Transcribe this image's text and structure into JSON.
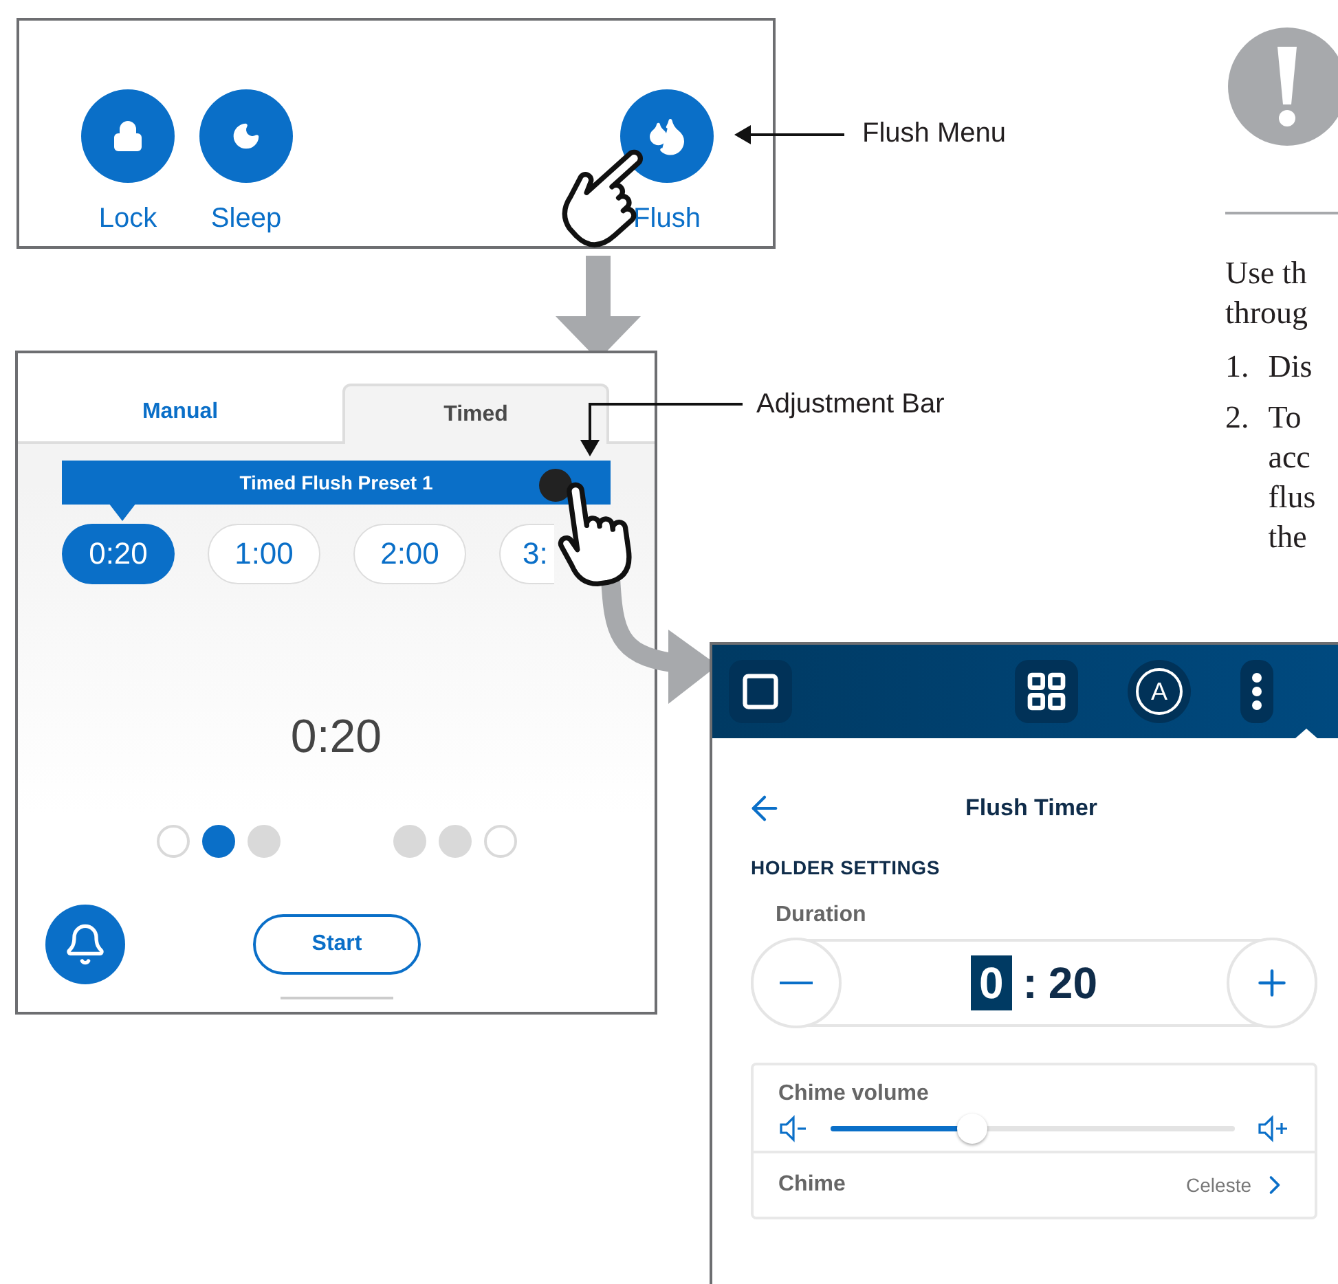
{
  "home_panel": {
    "buttons": [
      {
        "kind": "lock",
        "label": "Lock"
      },
      {
        "kind": "sleep",
        "label": "Sleep"
      },
      {
        "kind": "flush",
        "label": "Flush"
      }
    ]
  },
  "callouts": [
    {
      "label": "Flush Menu"
    },
    {
      "label": "Adjustment Bar"
    }
  ],
  "flush_panel": {
    "tabs": [
      {
        "label": "Manual",
        "selected": false
      },
      {
        "label": "Timed",
        "selected": true
      }
    ],
    "preset_bar": {
      "label": "Timed Flush Preset 1"
    },
    "presets": [
      {
        "label": "0:20",
        "selected": true
      },
      {
        "label": "1:00",
        "selected": false
      },
      {
        "label": "2:00",
        "selected": false
      },
      {
        "label": "3:",
        "selected": false
      }
    ],
    "display": "0:20",
    "dot_groups": [
      [
        {
          "kind": "empty"
        },
        {
          "kind": "current"
        },
        {
          "kind": "filled"
        }
      ],
      [
        {
          "kind": "filled"
        },
        {
          "kind": "filled"
        },
        {
          "kind": "empty"
        }
      ]
    ],
    "start_button": "Start"
  },
  "timer_panel": {
    "avatar": "A",
    "title": "Flush Timer",
    "section": "HOLDER SETTINGS",
    "duration_label": "Duration",
    "duration": {
      "minutes": "0",
      "separator": ":",
      "seconds": "20"
    },
    "volume": {
      "label": "Chime volume",
      "level": 0.35
    },
    "chime": {
      "label": "Chime",
      "value": "Celeste"
    }
  },
  "notice": {
    "intro_lines": [
      "Use th",
      "throug"
    ],
    "steps": [
      {
        "number": "1.",
        "lines": [
          "Dis"
        ]
      },
      {
        "number": "2.",
        "lines": [
          "To",
          "acc",
          "flus",
          "the"
        ]
      }
    ]
  }
}
